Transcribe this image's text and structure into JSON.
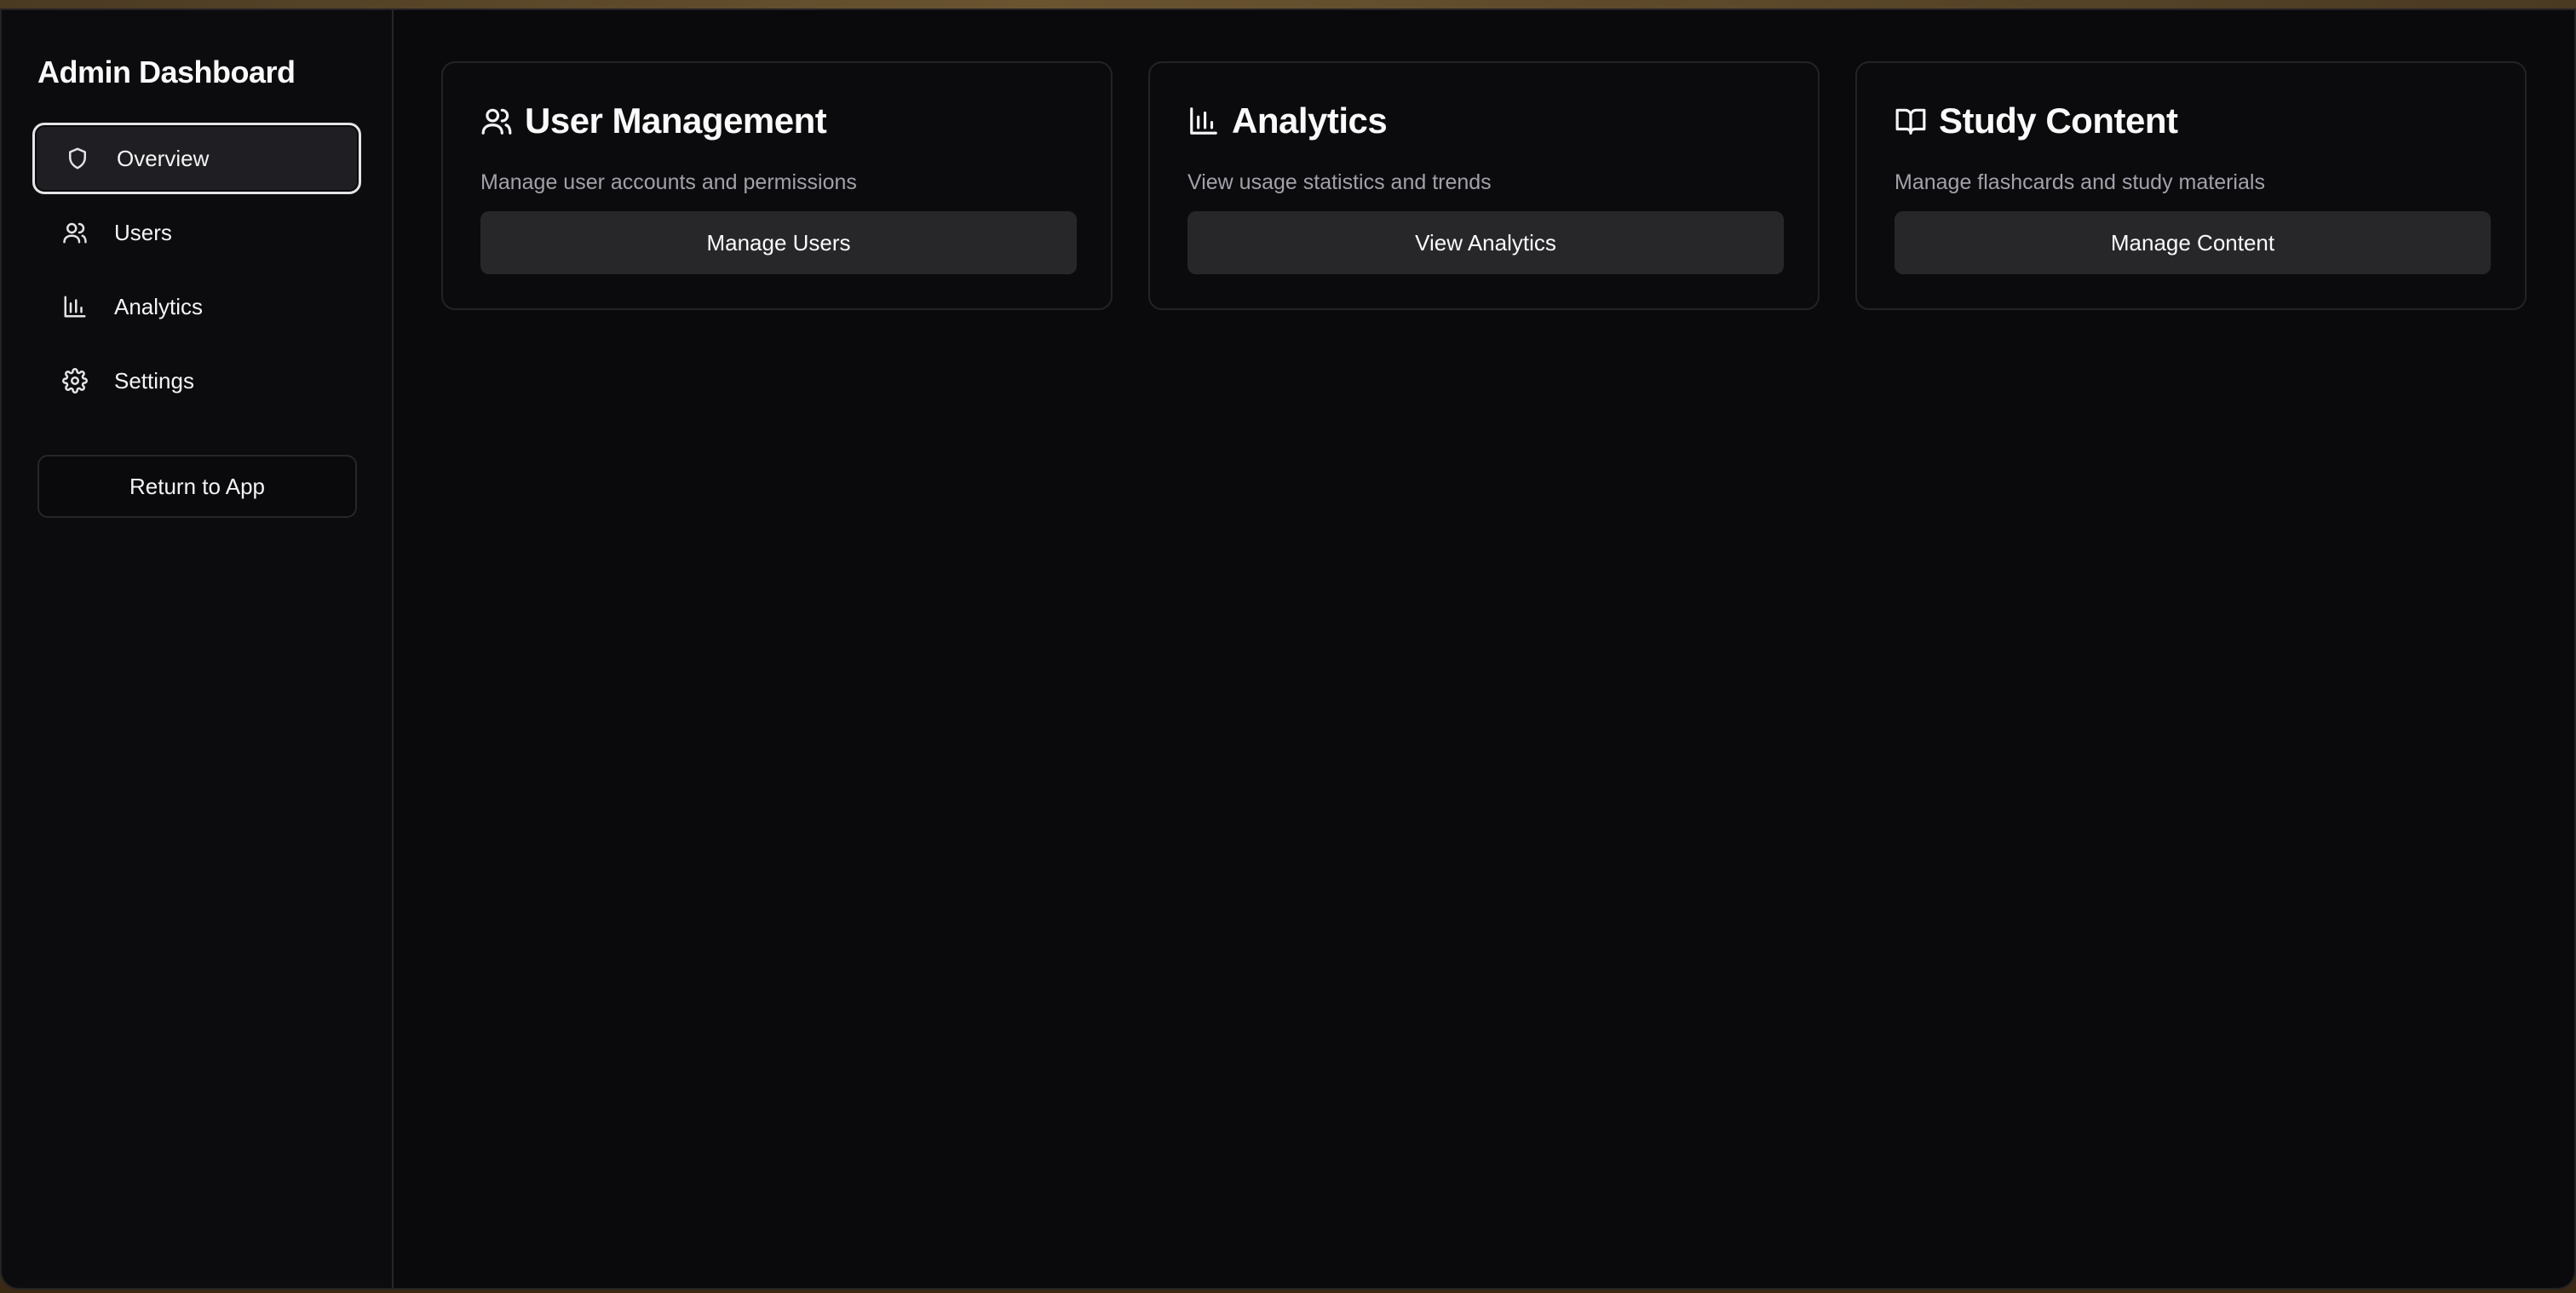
{
  "sidebar": {
    "title": "Admin Dashboard",
    "items": [
      {
        "label": "Overview",
        "icon": "shield-icon",
        "active": true
      },
      {
        "label": "Users",
        "icon": "users-icon",
        "active": false
      },
      {
        "label": "Analytics",
        "icon": "bar-chart-icon",
        "active": false
      },
      {
        "label": "Settings",
        "icon": "gear-icon",
        "active": false
      }
    ],
    "return_label": "Return to App"
  },
  "cards": [
    {
      "title": "User Management",
      "description": "Manage user accounts and permissions",
      "button": "Manage Users",
      "icon": "users-icon"
    },
    {
      "title": "Analytics",
      "description": "View usage statistics and trends",
      "button": "View Analytics",
      "icon": "bar-chart-icon"
    },
    {
      "title": "Study Content",
      "description": "Manage flashcards and study materials",
      "button": "Manage Content",
      "icon": "book-open-icon"
    }
  ],
  "colors": {
    "background": "#0a0a0c",
    "card_border": "#232327",
    "button_bg": "#27272a",
    "muted_text": "#a1a1aa",
    "active_border": "#e4e4e7"
  }
}
